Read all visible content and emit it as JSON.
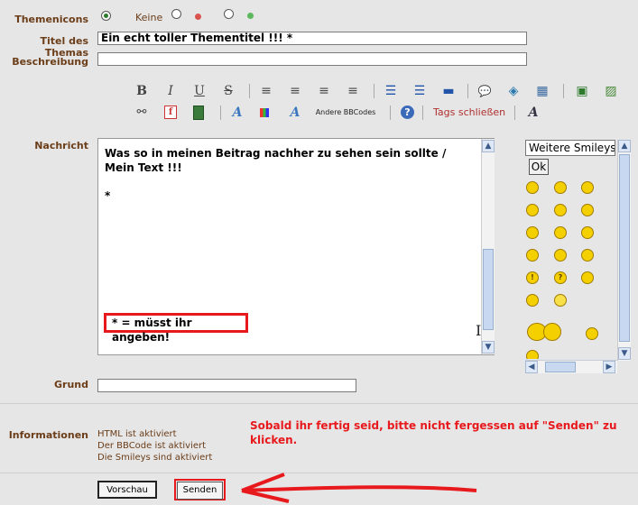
{
  "form": {
    "themeicons_label": "Themenicons",
    "themeicons_options": [
      {
        "label": "Keine",
        "selected": true
      },
      {
        "label": "",
        "selected": false,
        "color": "#d9534f"
      },
      {
        "label": "",
        "selected": false,
        "color": "#5cb85c"
      }
    ],
    "title_label": "Titel des Themas",
    "title_value": "Ein echt toller Thementitel !!!     *",
    "description_label": "Beschreibung",
    "description_value": "",
    "message_label": "Nachricht",
    "reason_label": "Grund",
    "reason_value": "",
    "info_label": "Informationen"
  },
  "toolbar": {
    "row1": [
      {
        "icon": "bold-icon",
        "glyph": "B"
      },
      {
        "icon": "italic-icon",
        "glyph": "I"
      },
      {
        "icon": "underline-icon",
        "glyph": "U"
      },
      {
        "icon": "strikethrough-icon",
        "glyph": "S"
      },
      {
        "icon": "align-left-icon",
        "glyph": "≡"
      },
      {
        "icon": "align-center-icon",
        "glyph": "≡"
      },
      {
        "icon": "align-right-icon",
        "glyph": "≡"
      },
      {
        "icon": "align-justify-icon",
        "glyph": "≡"
      },
      {
        "icon": "bullet-list-icon",
        "glyph": "☰"
      },
      {
        "icon": "numbered-list-icon",
        "glyph": "☰"
      },
      {
        "icon": "horizontal-rule-icon",
        "glyph": "▬"
      },
      {
        "icon": "quote-icon",
        "glyph": "💬"
      },
      {
        "icon": "code-icon",
        "glyph": "◈"
      },
      {
        "icon": "table-icon",
        "glyph": "▦"
      },
      {
        "icon": "insert-window-icon",
        "glyph": "▣"
      },
      {
        "icon": "image-icon",
        "glyph": "▨"
      }
    ],
    "row2_link_icon": "link-icon",
    "row2_flash_icon": "flash-icon",
    "row2_video_icon": "video-icon",
    "row2_font_icon": "font-icon",
    "row2_color_icon": "color-icon",
    "row2_size_icon": "font-size-icon",
    "other_bbcodes_label": "Andere BBCodes",
    "help_icon": "help-icon",
    "close_tags_label": "Tags schließen",
    "remove_format_icon": "remove-format-icon"
  },
  "editor": {
    "line1": "Was so in meinen Beitrag nachher zu sehen sein sollte /",
    "line2": "Mein Text !!!",
    "line3": "*",
    "note": "* = müsst ihr angeben!"
  },
  "smilies": {
    "select_value": "Weitere Smileys",
    "ok_label": "Ok",
    "faces": [
      "😀",
      "🙂",
      "😠",
      "🙁",
      "😑",
      "😎",
      "😆",
      "😛",
      "😉",
      "😕",
      "😲",
      "😊",
      "❗",
      "❓",
      "💡",
      "😶",
      "😐",
      "🙂"
    ]
  },
  "info": {
    "lines": [
      "HTML ist aktiviert",
      "Der BBCode ist aktiviert",
      "Die Smileys sind aktiviert"
    ],
    "annotation": "Sobald ihr fertig seid, bitte nicht fergessen auf \"Senden\" zu klicken."
  },
  "buttons": {
    "preview_label": "Vorschau",
    "send_label": "Senden"
  },
  "colors": {
    "label_brown": "#6b3d18",
    "annotation_red": "#e8191c",
    "tags_close_red": "#b03030"
  }
}
